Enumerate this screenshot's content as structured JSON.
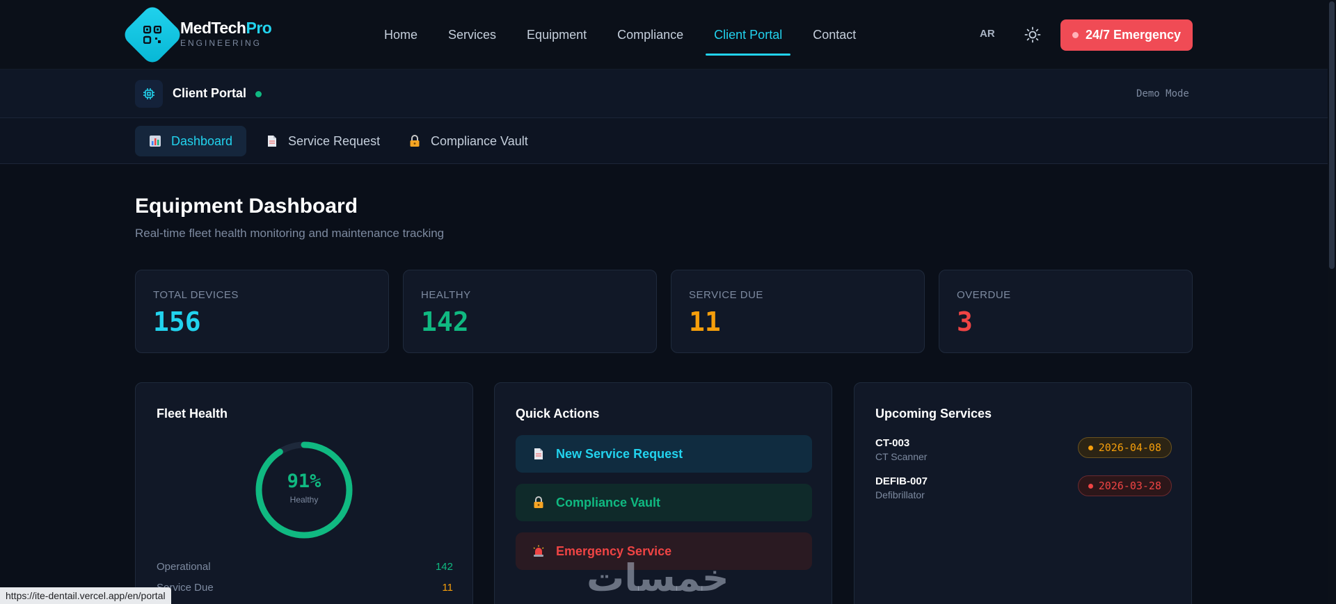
{
  "nav": {
    "brand_main": "MedTech",
    "brand_accent": "Pro",
    "brand_sub": "ENGINEERING",
    "links": [
      "Home",
      "Services",
      "Equipment",
      "Compliance",
      "Client Portal",
      "Contact"
    ],
    "active_link": "Client Portal",
    "lang": "AR",
    "emergency_label": "24/7 Emergency"
  },
  "portal": {
    "title": "Client Portal",
    "mode": "Demo Mode"
  },
  "subtabs": [
    {
      "label": "Dashboard",
      "icon": "bar-chart-icon"
    },
    {
      "label": "Service Request",
      "icon": "document-icon"
    },
    {
      "label": "Compliance Vault",
      "icon": "lock-icon"
    }
  ],
  "page": {
    "title": "Equipment Dashboard",
    "subtitle": "Real-time fleet health monitoring and maintenance tracking"
  },
  "stats": [
    {
      "label": "TOTAL DEVICES",
      "value": "156",
      "color": "#22d3ee"
    },
    {
      "label": "HEALTHY",
      "value": "142",
      "color": "#10b981"
    },
    {
      "label": "SERVICE DUE",
      "value": "11",
      "color": "#f59e0b"
    },
    {
      "label": "OVERDUE",
      "value": "3",
      "color": "#ef4444"
    }
  ],
  "fleet_health": {
    "title": "Fleet Health",
    "percent_label": "91%",
    "percent_value": 0.91,
    "gauge_caption": "Healthy",
    "rows": [
      {
        "label": "Operational",
        "value": "142",
        "color": "#10b981"
      },
      {
        "label": "Service Due",
        "value": "11",
        "color": "#f59e0b"
      }
    ]
  },
  "quick_actions": {
    "title": "Quick Actions",
    "items": [
      {
        "label": "New Service Request",
        "icon": "document-icon",
        "color": "#22d3ee",
        "bg": "#102c40"
      },
      {
        "label": "Compliance Vault",
        "icon": "lock-icon",
        "color": "#10b981",
        "bg": "#0f2a2a"
      },
      {
        "label": "Emergency Service",
        "icon": "siren-icon",
        "color": "#ef4444",
        "bg": "#2a1a22"
      }
    ]
  },
  "upcoming": {
    "title": "Upcoming Services",
    "items": [
      {
        "id": "CT-003",
        "type": "CT Scanner",
        "date": "2026-04-08",
        "color": "#f59e0b",
        "bg": "#2c2414",
        "border": "#6b5320"
      },
      {
        "id": "DEFIB-007",
        "type": "Defibrillator",
        "date": "2026-03-28",
        "color": "#ef4444",
        "bg": "#2c1619",
        "border": "#6b2a30"
      }
    ]
  },
  "watermark": "خمسات",
  "status_url": "https://ite-dentail.vercel.app/en/portal"
}
